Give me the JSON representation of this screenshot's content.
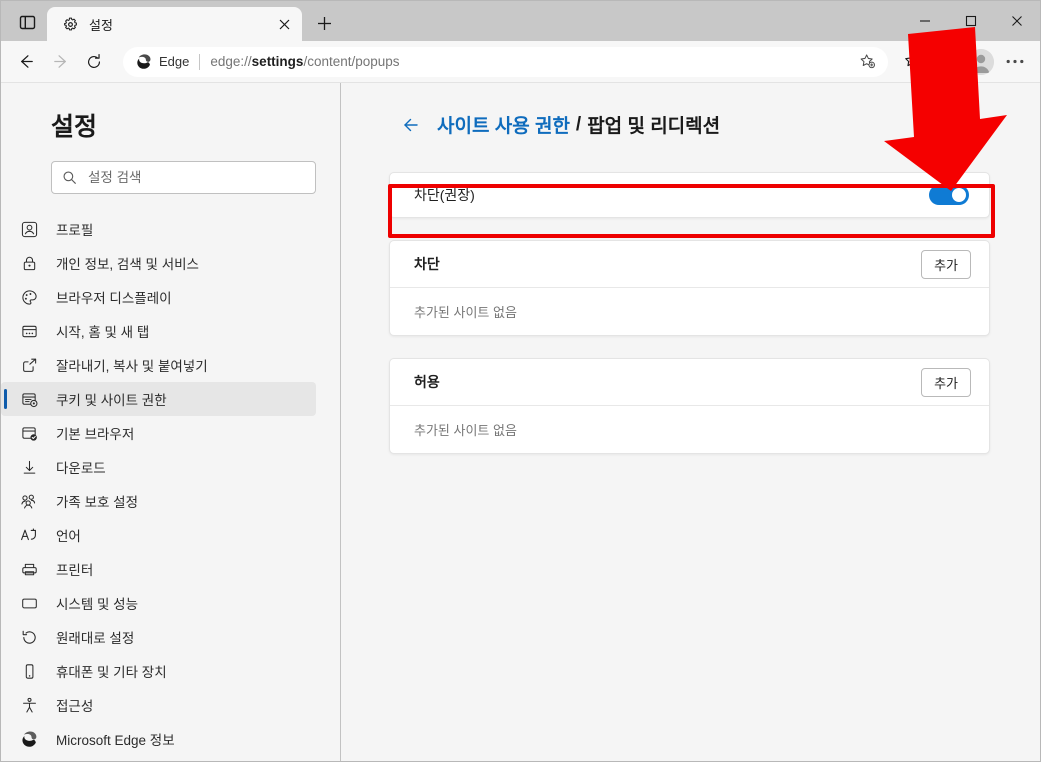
{
  "window": {
    "controls": {
      "minimize": "minimize-icon",
      "maximize": "maximize-icon",
      "close": "close-icon"
    },
    "tab_search_icon": "tab-actions-icon"
  },
  "tab": {
    "title": "설정",
    "favicon": "gear-icon",
    "close_icon": "close-icon",
    "new_tab_icon": "plus-icon"
  },
  "toolbar": {
    "back_icon": "back-arrow-icon",
    "forward_icon": "forward-arrow-icon",
    "refresh_icon": "refresh-icon",
    "edge_badge": "Edge",
    "url_prefix": "edge://",
    "url_bold": "settings",
    "url_suffix": "/content/popups",
    "favorite_icon": "add-favorite-star-icon",
    "favorites_icon": "favorites-list-icon",
    "collections_icon": "collections-icon",
    "profile_icon": "profile-avatar-icon",
    "more_icon": "more-options-icon"
  },
  "sidebar": {
    "title": "설정",
    "search": {
      "placeholder": "설정 검색",
      "value": "",
      "icon": "search-icon"
    },
    "items": [
      {
        "label": "프로필",
        "icon": "profile-icon",
        "selected": false
      },
      {
        "label": "개인 정보, 검색 및 서비스",
        "icon": "lock-icon",
        "selected": false
      },
      {
        "label": "브라우저 디스플레이",
        "icon": "palette-icon",
        "selected": false
      },
      {
        "label": "시작, 홈 및 새 탭",
        "icon": "browser-window-icon",
        "selected": false
      },
      {
        "label": "잘라내기, 복사 및 붙여넣기",
        "icon": "clipboard-share-icon",
        "selected": false
      },
      {
        "label": "쿠키 및 사이트 권한",
        "icon": "cookie-permissions-icon",
        "selected": true
      },
      {
        "label": "기본 브라우저",
        "icon": "default-browser-icon",
        "selected": false
      },
      {
        "label": "다운로드",
        "icon": "download-icon",
        "selected": false
      },
      {
        "label": "가족 보호 설정",
        "icon": "family-icon",
        "selected": false
      },
      {
        "label": "언어",
        "icon": "language-icon",
        "selected": false
      },
      {
        "label": "프린터",
        "icon": "printer-icon",
        "selected": false
      },
      {
        "label": "시스템 및 성능",
        "icon": "system-icon",
        "selected": false
      },
      {
        "label": "원래대로 설정",
        "icon": "reset-icon",
        "selected": false
      },
      {
        "label": "휴대폰 및 기타 장치",
        "icon": "phone-icon",
        "selected": false
      },
      {
        "label": "접근성",
        "icon": "accessibility-icon",
        "selected": false
      },
      {
        "label": "Microsoft Edge 정보",
        "icon": "edge-logo-icon",
        "selected": false
      }
    ]
  },
  "content": {
    "back_icon": "back-arrow-icon",
    "breadcrumb_parent": "사이트 사용 권한",
    "breadcrumb_separator": "/",
    "breadcrumb_current": "팝업 및 리디렉션",
    "toggle": {
      "label": "차단(권장)",
      "state": "on"
    },
    "sections": [
      {
        "title": "차단",
        "add_label": "추가",
        "empty_text": "추가된 사이트 없음"
      },
      {
        "title": "허용",
        "add_label": "추가",
        "empty_text": "추가된 사이트 없음"
      }
    ]
  },
  "annotations": {
    "highlight_color": "#ee0000",
    "arrow_color": "#f50000",
    "toggle_accent": "#0f7bd4",
    "link_color": "#0f6cbd"
  }
}
